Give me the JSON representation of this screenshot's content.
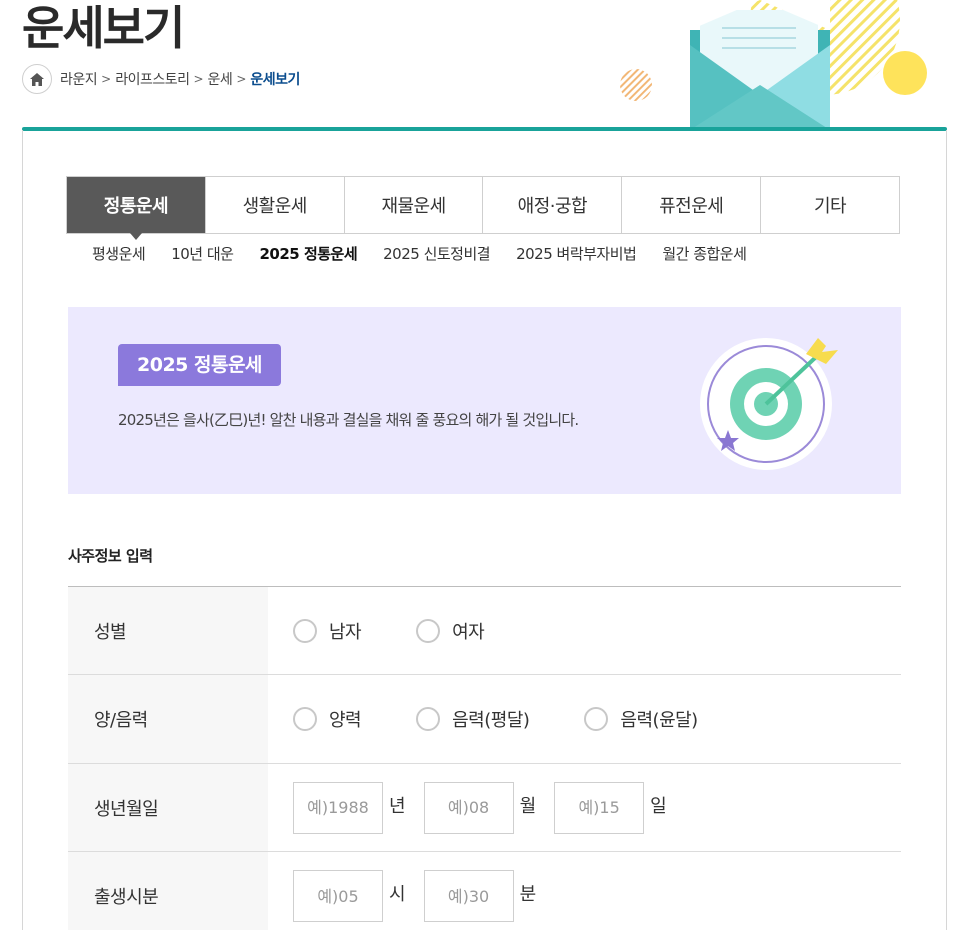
{
  "page": {
    "title": "운세보기"
  },
  "breadcrumb": {
    "items": [
      "라운지",
      "라이프스토리",
      "운세",
      "운세보기"
    ]
  },
  "tabs": [
    {
      "label": "정통운세",
      "active": true
    },
    {
      "label": "생활운세"
    },
    {
      "label": "재물운세"
    },
    {
      "label": "애정·궁합"
    },
    {
      "label": "퓨전운세"
    },
    {
      "label": "기타"
    }
  ],
  "subtabs": [
    {
      "label": "평생운세"
    },
    {
      "label": "10년 대운"
    },
    {
      "label": "2025 정통운세",
      "active": true
    },
    {
      "label": "2025 신토정비결"
    },
    {
      "label": "2025 벼락부자비법"
    },
    {
      "label": "월간 종합운세"
    }
  ],
  "banner": {
    "badge": "2025 정통운세",
    "description": "2025년은 을사(乙巳)년! 알찬 내용과 결실을 채워 줄 풍요의 해가 될 것입니다."
  },
  "form": {
    "section_title": "사주정보 입력",
    "gender": {
      "label": "성별",
      "options": [
        "남자",
        "여자"
      ]
    },
    "calendar": {
      "label": "양/음력",
      "options": [
        "양력",
        "음력(평달)",
        "음력(윤달)"
      ]
    },
    "birth_date": {
      "label": "생년월일",
      "year_placeholder": "예)1988",
      "year_unit": "년",
      "month_placeholder": "예)08",
      "month_unit": "월",
      "day_placeholder": "예)15",
      "day_unit": "일"
    },
    "birth_time": {
      "label": "출생시분",
      "hour_placeholder": "예)05",
      "hour_unit": "시",
      "minute_placeholder": "예)30",
      "minute_unit": "분"
    }
  },
  "colors": {
    "accent": "#19a39a",
    "active_tab": "#595959",
    "banner_bg": "#ece9fe",
    "badge": "#8b79dc",
    "breadcrumb_current": "#0b4d8e"
  },
  "icons": {
    "home": "home-icon",
    "header": "envelope-illustration",
    "banner": "target-illustration"
  }
}
